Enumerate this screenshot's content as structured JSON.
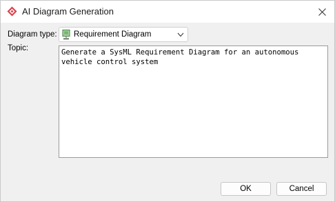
{
  "window": {
    "title": "AI Diagram Generation",
    "accent_color": "#d9414a"
  },
  "form": {
    "diagram_type_label": "Diagram type:",
    "diagram_type_value": "Requirement Diagram",
    "diagram_type_icon": "requirement-diagram-icon",
    "topic_label": "Topic:",
    "topic_value": "Generate a SysML Requirement Diagram for an autonomous vehicle control system"
  },
  "buttons": {
    "ok": "OK",
    "cancel": "Cancel"
  }
}
